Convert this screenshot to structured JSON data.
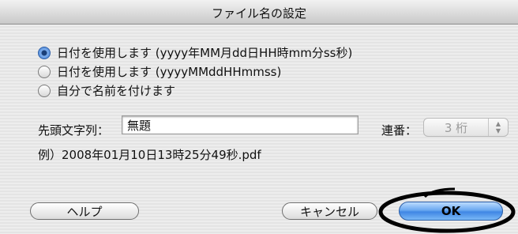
{
  "dialog": {
    "title": "ファイル名の設定"
  },
  "options": [
    {
      "label": "日付を使用します (yyyy年MM月dd日HH時mm分ss秒)",
      "selected": true
    },
    {
      "label": "日付を使用します (yyyyMMddHHmmss)",
      "selected": false
    },
    {
      "label": "自分で名前を付けます",
      "selected": false
    }
  ],
  "prefix": {
    "label": "先頭文字列：",
    "value": "無題"
  },
  "sequence": {
    "label": "連番：",
    "value": "3 桁"
  },
  "example": {
    "text": "例）2008年01月10日13時25分49秒.pdf"
  },
  "buttons": {
    "help": "ヘルプ",
    "cancel": "キャンセル",
    "ok": "OK"
  },
  "colors": {
    "default_button": "#3f86e4",
    "highlight_ring": "#000000"
  }
}
